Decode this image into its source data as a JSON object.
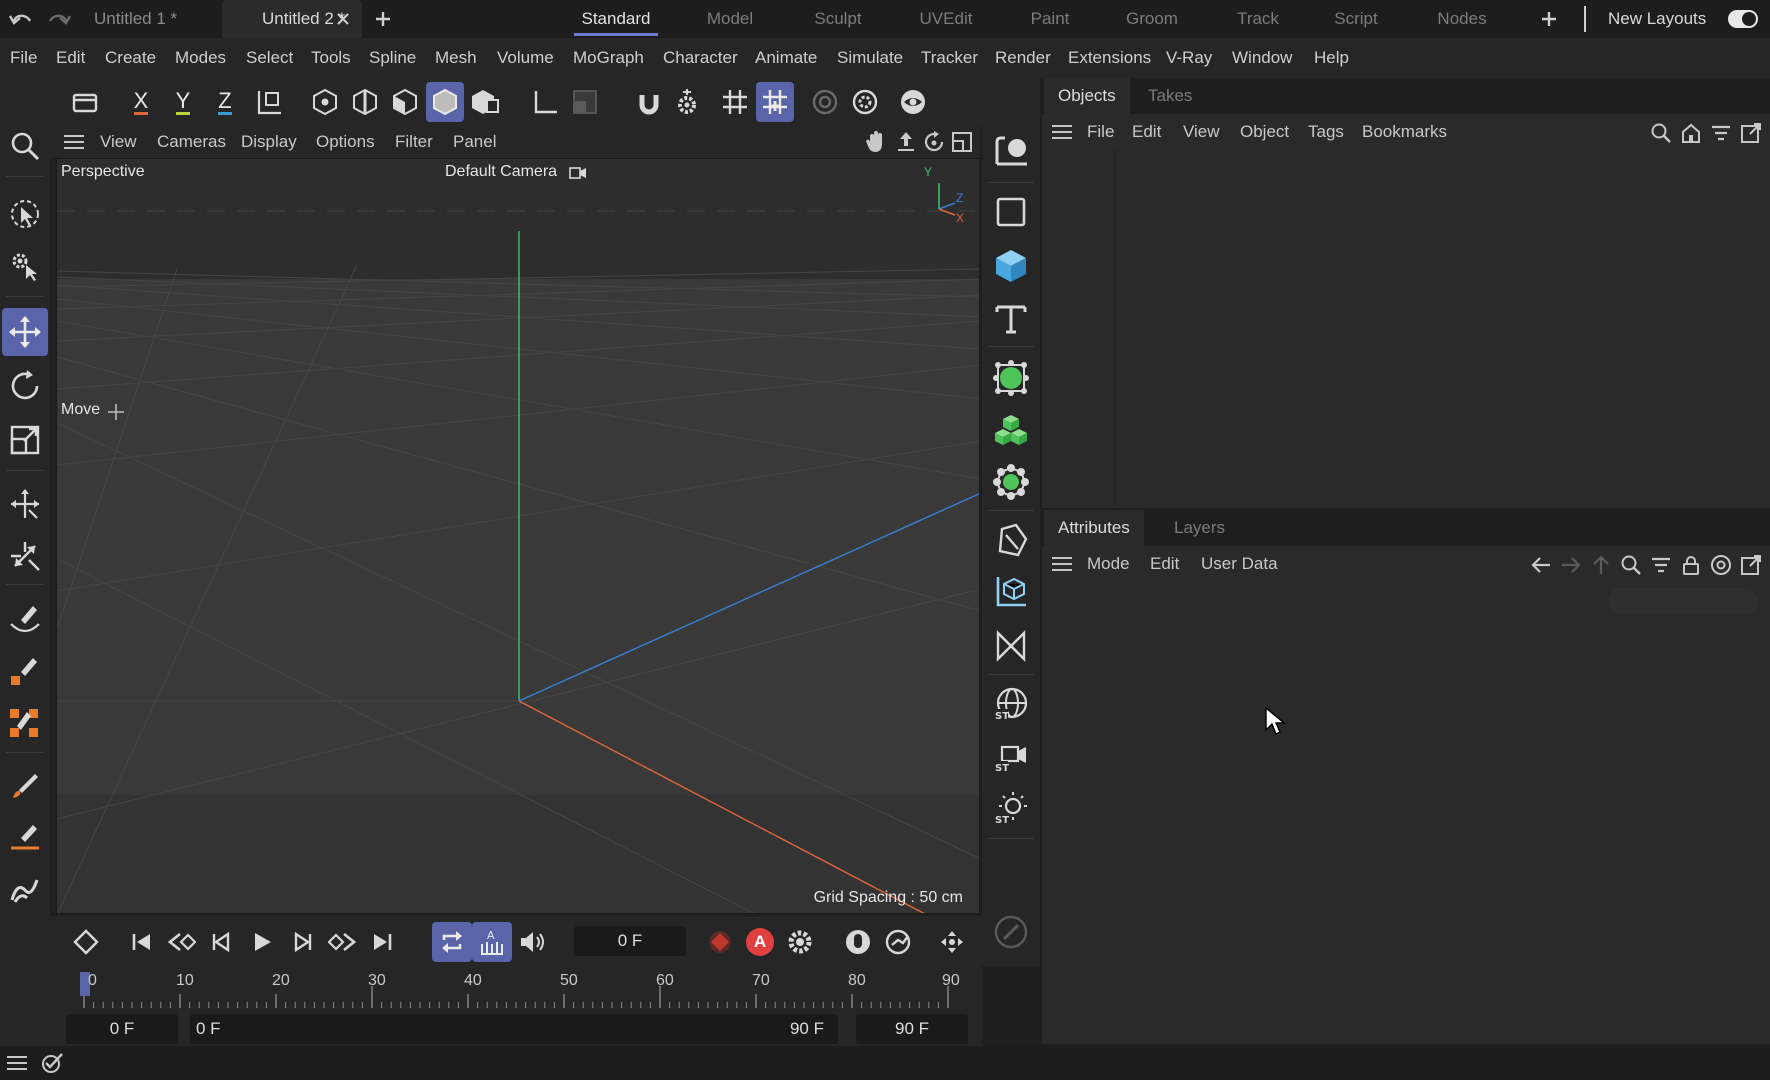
{
  "tabs": {
    "documents": [
      {
        "label": "Untitled 1 *",
        "active": false
      },
      {
        "label": "Untitled 2 *",
        "active": true
      }
    ],
    "layouts": [
      "Standard",
      "Model",
      "Sculpt",
      "UVEdit",
      "Paint",
      "Groom",
      "Track",
      "Script",
      "Nodes"
    ],
    "active_layout": "Standard",
    "new_layouts_label": "New Layouts"
  },
  "menubar": [
    "File",
    "Edit",
    "Create",
    "Modes",
    "Select",
    "Tools",
    "Spline",
    "Mesh",
    "Volume",
    "MoGraph",
    "Character",
    "Animate",
    "Simulate",
    "Tracker",
    "Render",
    "Extensions",
    "V-Ray",
    "Window",
    "Help"
  ],
  "toolbar": {
    "axis_x": "X",
    "axis_y": "Y",
    "axis_z": "Z"
  },
  "viewport": {
    "menu": [
      "View",
      "Cameras",
      "Display",
      "Options",
      "Filter",
      "Panel"
    ],
    "projection_label": "Perspective",
    "camera_label": "Default Camera",
    "tool_label": "Move",
    "grid_spacing": "Grid Spacing : 50 cm",
    "axis_labels": {
      "y": "Y",
      "z": "Z",
      "x": "X"
    }
  },
  "timeline": {
    "current_frame": "0 F",
    "start_frame": "0 F",
    "range_start": "0 F",
    "range_end": "90 F",
    "end_frame": "90 F",
    "ruler_labels": [
      "0",
      "10",
      "20",
      "30",
      "40",
      "50",
      "60",
      "70",
      "80",
      "90"
    ],
    "autokey_letter": "A"
  },
  "objects_panel": {
    "tabs": [
      "Objects",
      "Takes"
    ],
    "menu": [
      "File",
      "Edit",
      "View",
      "Object",
      "Tags",
      "Bookmarks"
    ]
  },
  "attributes_panel": {
    "tabs": [
      "Attributes",
      "Layers"
    ],
    "menu": [
      "Mode",
      "Edit",
      "User Data"
    ]
  },
  "colors": {
    "accent": "#5a64a8",
    "axis_x": "#e0663a",
    "axis_y": "#4ec47a",
    "axis_z": "#3a7fd6",
    "primitive_blue": "#4aa8e0",
    "generator_green": "#4ec45a"
  }
}
